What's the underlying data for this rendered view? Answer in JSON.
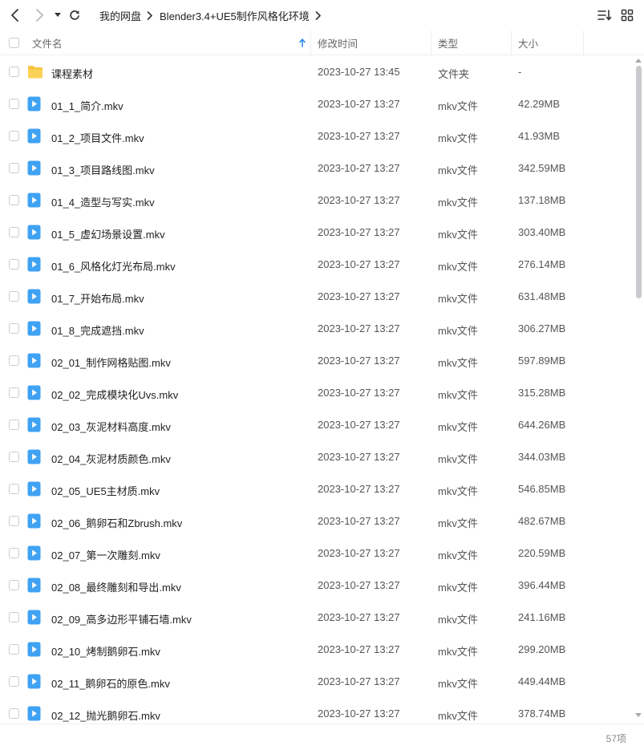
{
  "toolbar": {
    "back_icon": "chevron-left-icon",
    "forward_icon": "chevron-right-icon",
    "history_icon": "caret-down-icon",
    "refresh_icon": "refresh-icon",
    "sort_icon": "sort-list-icon",
    "view_icon": "grid-view-icon"
  },
  "breadcrumb": [
    "我的网盘",
    "Blender3.4+UE5制作风格化环境"
  ],
  "columns": {
    "name": "文件名",
    "modified": "修改时间",
    "type": "类型",
    "size": "大小"
  },
  "colors": {
    "accent": "#2b8cf0",
    "folder": "#f7c33d",
    "video": "#3fa2f3"
  },
  "files": [
    {
      "name": "课程素材",
      "date": "2023-10-27 13:45",
      "type": "文件夹",
      "size": "-",
      "icon": "folder-icon"
    },
    {
      "name": "01_1_简介.mkv",
      "date": "2023-10-27 13:27",
      "type": "mkv文件",
      "size": "42.29MB",
      "icon": "video-file-icon"
    },
    {
      "name": "01_2_项目文件.mkv",
      "date": "2023-10-27 13:27",
      "type": "mkv文件",
      "size": "41.93MB",
      "icon": "video-file-icon"
    },
    {
      "name": "01_3_项目路线图.mkv",
      "date": "2023-10-27 13:27",
      "type": "mkv文件",
      "size": "342.59MB",
      "icon": "video-file-icon"
    },
    {
      "name": "01_4_造型与写实.mkv",
      "date": "2023-10-27 13:27",
      "type": "mkv文件",
      "size": "137.18MB",
      "icon": "video-file-icon"
    },
    {
      "name": "01_5_虚幻场景设置.mkv",
      "date": "2023-10-27 13:27",
      "type": "mkv文件",
      "size": "303.40MB",
      "icon": "video-file-icon"
    },
    {
      "name": "01_6_风格化灯光布局.mkv",
      "date": "2023-10-27 13:27",
      "type": "mkv文件",
      "size": "276.14MB",
      "icon": "video-file-icon"
    },
    {
      "name": "01_7_开始布局.mkv",
      "date": "2023-10-27 13:27",
      "type": "mkv文件",
      "size": "631.48MB",
      "icon": "video-file-icon"
    },
    {
      "name": "01_8_完成遮挡.mkv",
      "date": "2023-10-27 13:27",
      "type": "mkv文件",
      "size": "306.27MB",
      "icon": "video-file-icon"
    },
    {
      "name": "02_01_制作网格贴图.mkv",
      "date": "2023-10-27 13:27",
      "type": "mkv文件",
      "size": "597.89MB",
      "icon": "video-file-icon"
    },
    {
      "name": "02_02_完成模块化Uvs.mkv",
      "date": "2023-10-27 13:27",
      "type": "mkv文件",
      "size": "315.28MB",
      "icon": "video-file-icon"
    },
    {
      "name": "02_03_灰泥材料高度.mkv",
      "date": "2023-10-27 13:27",
      "type": "mkv文件",
      "size": "644.26MB",
      "icon": "video-file-icon"
    },
    {
      "name": "02_04_灰泥材质颜色.mkv",
      "date": "2023-10-27 13:27",
      "type": "mkv文件",
      "size": "344.03MB",
      "icon": "video-file-icon"
    },
    {
      "name": "02_05_UE5主材质.mkv",
      "date": "2023-10-27 13:27",
      "type": "mkv文件",
      "size": "546.85MB",
      "icon": "video-file-icon"
    },
    {
      "name": "02_06_鹅卵石和Zbrush.mkv",
      "date": "2023-10-27 13:27",
      "type": "mkv文件",
      "size": "482.67MB",
      "icon": "video-file-icon"
    },
    {
      "name": "02_07_第一次雕刻.mkv",
      "date": "2023-10-27 13:27",
      "type": "mkv文件",
      "size": "220.59MB",
      "icon": "video-file-icon"
    },
    {
      "name": "02_08_最终雕刻和导出.mkv",
      "date": "2023-10-27 13:27",
      "type": "mkv文件",
      "size": "396.44MB",
      "icon": "video-file-icon"
    },
    {
      "name": "02_09_高多边形平铺石墙.mkv",
      "date": "2023-10-27 13:27",
      "type": "mkv文件",
      "size": "241.16MB",
      "icon": "video-file-icon"
    },
    {
      "name": "02_10_烤制鹅卵石.mkv",
      "date": "2023-10-27 13:27",
      "type": "mkv文件",
      "size": "299.20MB",
      "icon": "video-file-icon"
    },
    {
      "name": "02_11_鹅卵石的原色.mkv",
      "date": "2023-10-27 13:27",
      "type": "mkv文件",
      "size": "449.44MB",
      "icon": "video-file-icon"
    },
    {
      "name": "02_12_抛光鹅卵石.mkv",
      "date": "2023-10-27 13:27",
      "type": "mkv文件",
      "size": "378.74MB",
      "icon": "video-file-icon"
    }
  ],
  "footer": {
    "count": "57项"
  }
}
